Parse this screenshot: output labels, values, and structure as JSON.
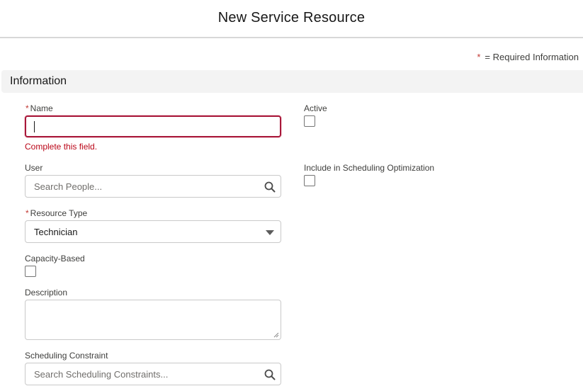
{
  "modal": {
    "title": "New Service Resource",
    "required_star": "*",
    "required_legend": "= Required Information"
  },
  "section": {
    "title": "Information"
  },
  "fields": {
    "name": {
      "label": "Name",
      "required": "*",
      "value": "",
      "error": "Complete this field."
    },
    "active": {
      "label": "Active",
      "checked": false
    },
    "user": {
      "label": "User",
      "placeholder": "Search People..."
    },
    "include_optimization": {
      "label": "Include in Scheduling Optimization",
      "checked": false
    },
    "resource_type": {
      "label": "Resource Type",
      "required": "*",
      "value": "Technician"
    },
    "capacity_based": {
      "label": "Capacity-Based",
      "checked": false
    },
    "description": {
      "label": "Description",
      "value": ""
    },
    "scheduling_constraint": {
      "label": "Scheduling Constraint",
      "placeholder": "Search Scheduling Constraints..."
    }
  },
  "icons": {
    "search": "search-icon",
    "dropdown": "chevron-down-icon"
  },
  "colors": {
    "error": "#ba0517",
    "required": "#c23934",
    "section_bg": "#f3f3f3"
  }
}
